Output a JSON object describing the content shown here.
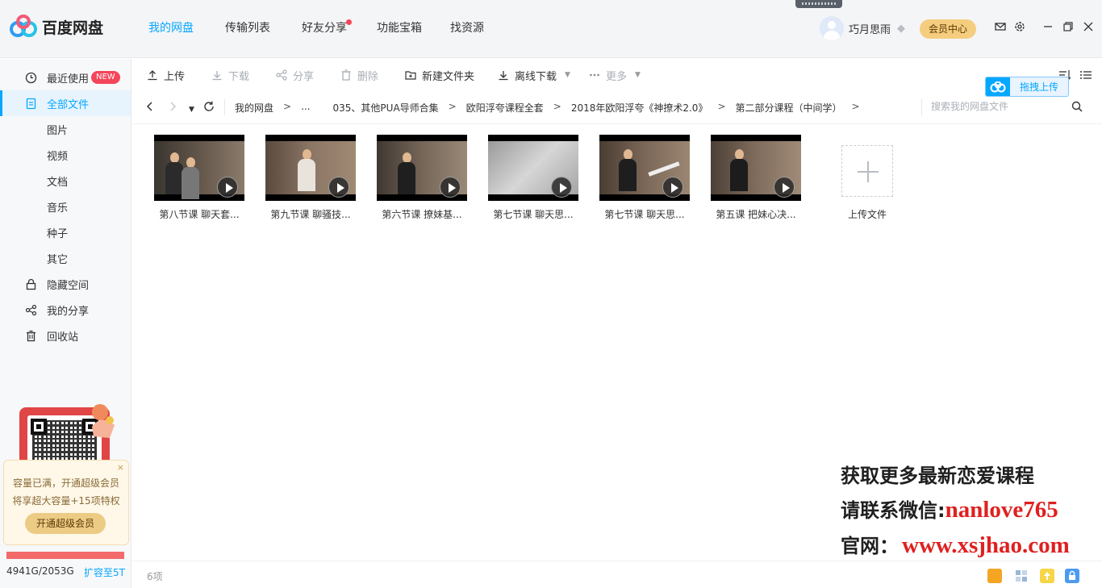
{
  "app": {
    "name": "百度网盘"
  },
  "nav": {
    "items": [
      {
        "label": "我的网盘",
        "active": true
      },
      {
        "label": "传输列表",
        "active": false
      },
      {
        "label": "好友分享",
        "active": false,
        "has_dot": true
      },
      {
        "label": "功能宝箱",
        "active": false
      },
      {
        "label": "找资源",
        "active": false
      }
    ]
  },
  "user": {
    "name": "巧月思雨",
    "vip_center_label": "会员中心"
  },
  "sidebar": {
    "items": [
      {
        "label": "最近使用",
        "icon": "clock-icon",
        "badge": "NEW"
      },
      {
        "label": "全部文件",
        "icon": "document-icon",
        "active": true
      },
      {
        "label": "图片"
      },
      {
        "label": "视频"
      },
      {
        "label": "文档"
      },
      {
        "label": "音乐"
      },
      {
        "label": "种子"
      },
      {
        "label": "其它"
      },
      {
        "label": "隐藏空间",
        "icon": "lock-icon"
      },
      {
        "label": "我的分享",
        "icon": "share-icon"
      },
      {
        "label": "回收站",
        "icon": "trash-icon"
      }
    ],
    "storage_notice": {
      "line1": "容量已满，开通超级会员",
      "line2": "将享超大容量+15项特权",
      "button": "开通超级会员",
      "close": "×"
    },
    "quota": {
      "used_text": "4941G/2053G",
      "expand_label": "扩容至5T"
    }
  },
  "toolbar": {
    "upload": "上传",
    "download": "下载",
    "share": "分享",
    "delete": "删除",
    "new_folder": "新建文件夹",
    "offline_download": "离线下载",
    "more": "更多",
    "drag_upload": "拖拽上传"
  },
  "breadcrumb": {
    "items": [
      "我的网盘",
      "...",
      "035、其他PUA导师合集",
      "欧阳浮夸课程全套",
      "2018年欧阳浮夸《神撩术2.0》",
      "第二部分课程（中间学）"
    ],
    "separator": ">"
  },
  "search": {
    "placeholder": "搜索我的网盘文件"
  },
  "files": [
    {
      "name": "第八节课 聊天套...",
      "type": "video"
    },
    {
      "name": "第九节课 聊骚技...",
      "type": "video"
    },
    {
      "name": "第六节课  撩妹基...",
      "type": "video"
    },
    {
      "name": "第七节课 聊天思...",
      "type": "video"
    },
    {
      "name": "第七节课 聊天思...",
      "type": "video"
    },
    {
      "name": "第五课 把妹心决...",
      "type": "video"
    }
  ],
  "upload_tile": {
    "label": "上传文件"
  },
  "watermark": {
    "line1": "获取更多最新恋爱课程",
    "line2_prefix": "请联系微信:",
    "line2_value": "nanlove765",
    "line3_prefix": "官网：",
    "line3_value": "www.xsjhao.com"
  },
  "status": {
    "count": "6项"
  },
  "colors": {
    "accent": "#06a7ff",
    "badge_red": "#f5455a",
    "vip_gold": "#f5cd7e",
    "watermark_red": "#e02020"
  }
}
